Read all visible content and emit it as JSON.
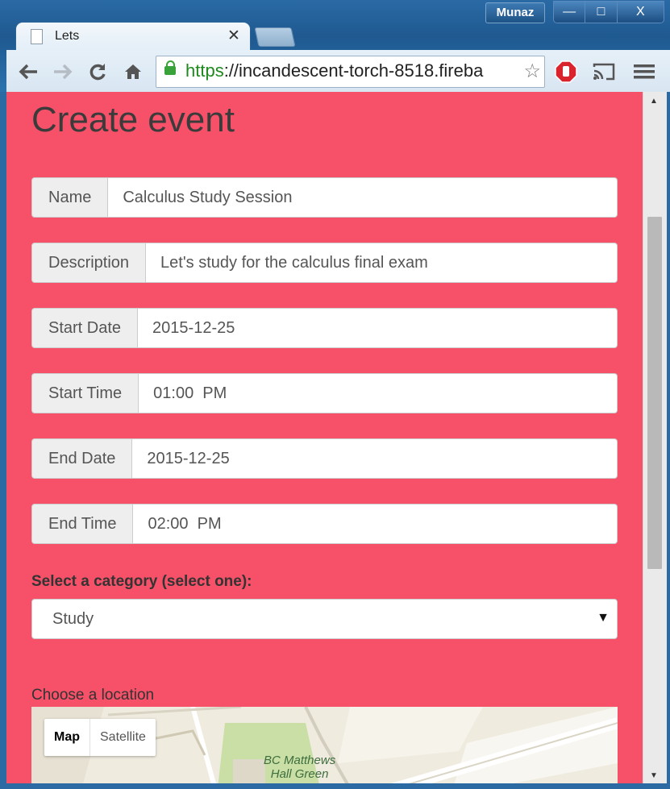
{
  "window": {
    "user": "Munaz",
    "min": "—",
    "max": "□",
    "close": "X"
  },
  "tab": {
    "title": "Lets",
    "close": "✕"
  },
  "toolbar": {
    "url_protocol": "https",
    "url_rest": "://incandescent-torch-8518.fireba",
    "star": "☆"
  },
  "page": {
    "heading": "Create event",
    "fields": [
      {
        "label": "Name",
        "value": "Calculus Study Session"
      },
      {
        "label": "Description",
        "value": "Let's study for the calculus final exam"
      },
      {
        "label": "Start Date",
        "value": "2015-12-25"
      },
      {
        "label": "Start Time",
        "value": "01:00  PM"
      },
      {
        "label": "End Date",
        "value": "2015-12-25"
      },
      {
        "label": "End Time",
        "value": "02:00  PM"
      }
    ],
    "category_label": "Select a category (select one):",
    "category_selected": "Study",
    "location_label": "Choose a location",
    "map": {
      "btn_map": "Map",
      "btn_satellite": "Satellite",
      "place_line1": "BC Matthews",
      "place_line2": "Hall Green"
    }
  }
}
